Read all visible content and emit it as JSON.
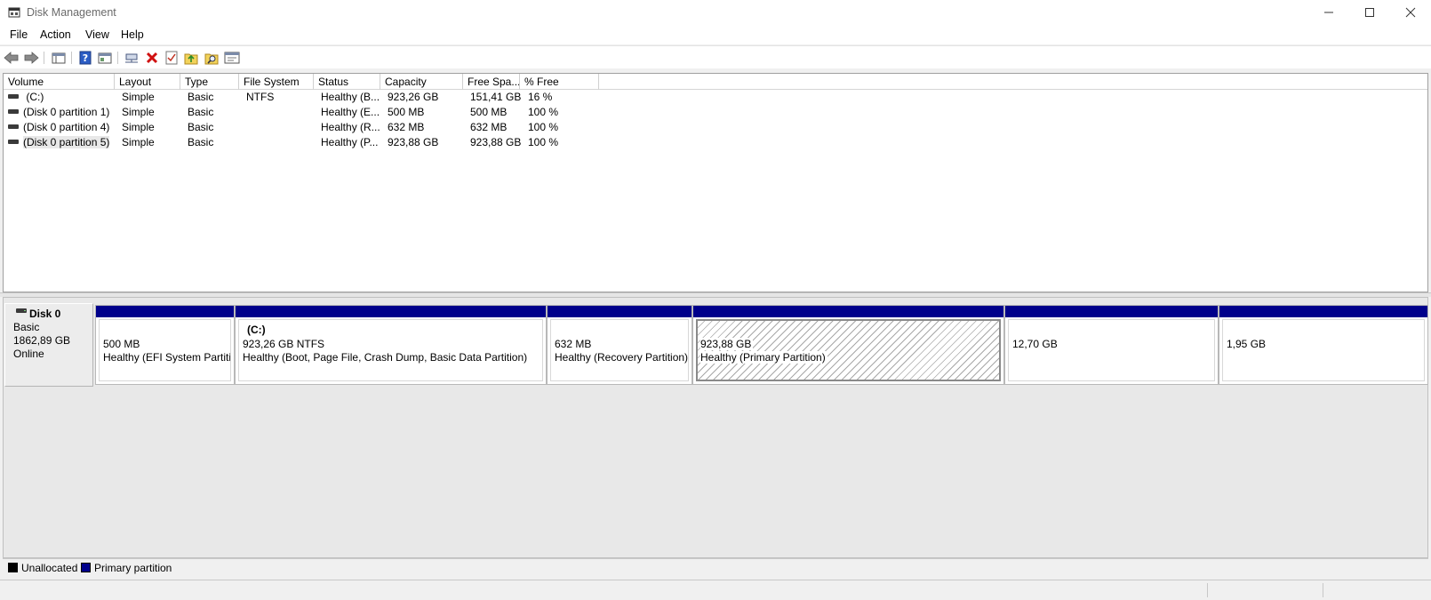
{
  "window": {
    "title": "Disk Management"
  },
  "menu": [
    "File",
    "Action",
    "View",
    "Help"
  ],
  "toolbar_icons": [
    "back-arrow-icon",
    "forward-arrow-icon",
    "console-tree-icon",
    "help-icon",
    "show-hide-pane-icon",
    "connect-disk-icon",
    "delete-icon",
    "check-disk-icon",
    "import-icon",
    "search-icon",
    "properties-icon"
  ],
  "columns": [
    "Volume",
    "Layout",
    "Type",
    "File System",
    "Status",
    "Capacity",
    "Free Spa...",
    "% Free"
  ],
  "volumes": [
    {
      "volume": "(C:)",
      "layout": "Simple",
      "type": "Basic",
      "fs": "NTFS",
      "status": "Healthy (B...",
      "capacity": "923,26 GB",
      "free": "151,41 GB",
      "pct": "16 %"
    },
    {
      "volume": "(Disk 0 partition 1)",
      "layout": "Simple",
      "type": "Basic",
      "fs": "",
      "status": "Healthy (E...",
      "capacity": "500 MB",
      "free": "500 MB",
      "pct": "100 %"
    },
    {
      "volume": "(Disk 0 partition 4)",
      "layout": "Simple",
      "type": "Basic",
      "fs": "",
      "status": "Healthy (R...",
      "capacity": "632 MB",
      "free": "632 MB",
      "pct": "100 %"
    },
    {
      "volume": "(Disk 0 partition 5)",
      "layout": "Simple",
      "type": "Basic",
      "fs": "",
      "status": "Healthy (P...",
      "capacity": "923,88 GB",
      "free": "923,88 GB",
      "pct": "100 %"
    }
  ],
  "disk": {
    "name": "Disk 0",
    "type": "Basic",
    "size": "1862,89 GB",
    "state": "Online"
  },
  "partitions": [
    {
      "name": "",
      "size": "500 MB",
      "status": "Healthy (EFI System Partitio"
    },
    {
      "name": "(C:)",
      "size": "923,26 GB NTFS",
      "status": "Healthy (Boot, Page File, Crash Dump, Basic Data Partition)"
    },
    {
      "name": "",
      "size": "632 MB",
      "status": "Healthy (Recovery Partition)"
    },
    {
      "name": "",
      "size": "923,88 GB",
      "status": "Healthy (Primary Partition)"
    },
    {
      "name": "",
      "size": "12,70 GB",
      "status": ""
    },
    {
      "name": "",
      "size": "1,95 GB",
      "status": ""
    }
  ],
  "legend": [
    {
      "label": "Unallocated",
      "color": "#000000"
    },
    {
      "label": "Primary partition",
      "color": "#00008b"
    }
  ],
  "colors": {
    "primary_partition_bar": "#00008b",
    "window_bg": "#f0f0f0"
  }
}
